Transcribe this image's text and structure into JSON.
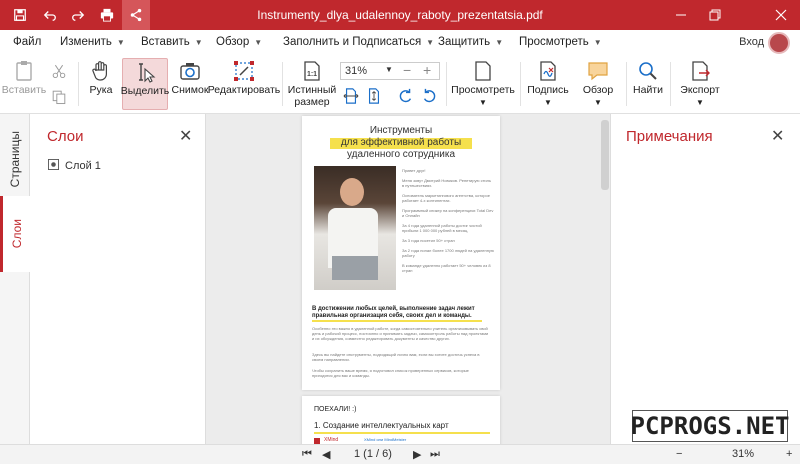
{
  "title": "Instrumenty_dlya_udalennoy_raboty_prezentatsia.pdf",
  "menu": {
    "items": [
      {
        "label": "Файл",
        "arrow": false
      },
      {
        "label": "Изменить",
        "arrow": true
      },
      {
        "label": "Вставить",
        "arrow": true
      },
      {
        "label": "Обзор",
        "arrow": true
      },
      {
        "label": "Заполнить и Подписаться",
        "arrow": true
      },
      {
        "label": "Защитить",
        "arrow": true
      },
      {
        "label": "Просмотреть",
        "arrow": true
      }
    ],
    "login": "Вход"
  },
  "ribbon": {
    "paste": "Вставить",
    "hand": "Рука",
    "select": "Выделить",
    "snapshot": "Снимок",
    "edit": "Редактировать",
    "actual_size_1": "Истинный",
    "actual_size_2": "размер",
    "zoom": "31%",
    "view": "Просмотреть",
    "sign": "Подпись",
    "review": "Обзор",
    "find": "Найти",
    "export": "Экспорт"
  },
  "sidetabs": {
    "pages": "Страницы",
    "layers": "Слои"
  },
  "layers_panel": {
    "title": "Слои",
    "layer1": "Слой 1"
  },
  "notes_panel": {
    "title": "Примечания"
  },
  "document": {
    "heading1": "Инструменты",
    "heading2": "для эффективной работы",
    "heading3": "удаленного сотрудника",
    "bullets": [
      "Привет друг!",
      "Меня зовут Дмитрий Новиков. Репетирую стиль в путешествиях.",
      "Основатель маркетингового агентства, которое работает 4-х континентах.",
      "Программный спикер на конференциях Total Dev и Онлайн",
      "За 4 года удаленной работы достиг чистой прибыли 1 000 000 рублей в месяц.",
      "За 3 года посетил 50+ стран",
      "За 2 года попал более 1700 людей на удаленную работу",
      "В команде удаленно работает 50+ человек из 8 стран"
    ],
    "goal_bold": "В достижении любых целей, выполнение задач лежит правильная организация себя, своих дел и команды.",
    "para1": "Особенно это важно в удаленной работе, когда самостоятельно учитель организовывать свой день и рабочий процесс, постоянно и принимать задачи, самоконтроль работы над проектами и их обсуждения, совместно редактировать документы и качество других.",
    "para2": "Здесь вы найдете инструменты, подходящий лично вам, если вы хотите достичь успеха в своем направлении.",
    "para3": "Чтобы сохранить ваше время, я подготовил список проверенных сервисов, которые пригодятся для вас и команды.",
    "page2_title": "ПОЕХАЛИ! :)",
    "page2_h": "1. Создание интеллектуальных карт",
    "page2_item": "XMind",
    "page2_item_desc": "XMind или MindMeister"
  },
  "status": {
    "page": "1 (1 / 6)",
    "zoom": "31%"
  },
  "watermark": "PCPROGS.NET",
  "colors": {
    "accent": "#c0282d",
    "highlight": "#f5e04d"
  }
}
